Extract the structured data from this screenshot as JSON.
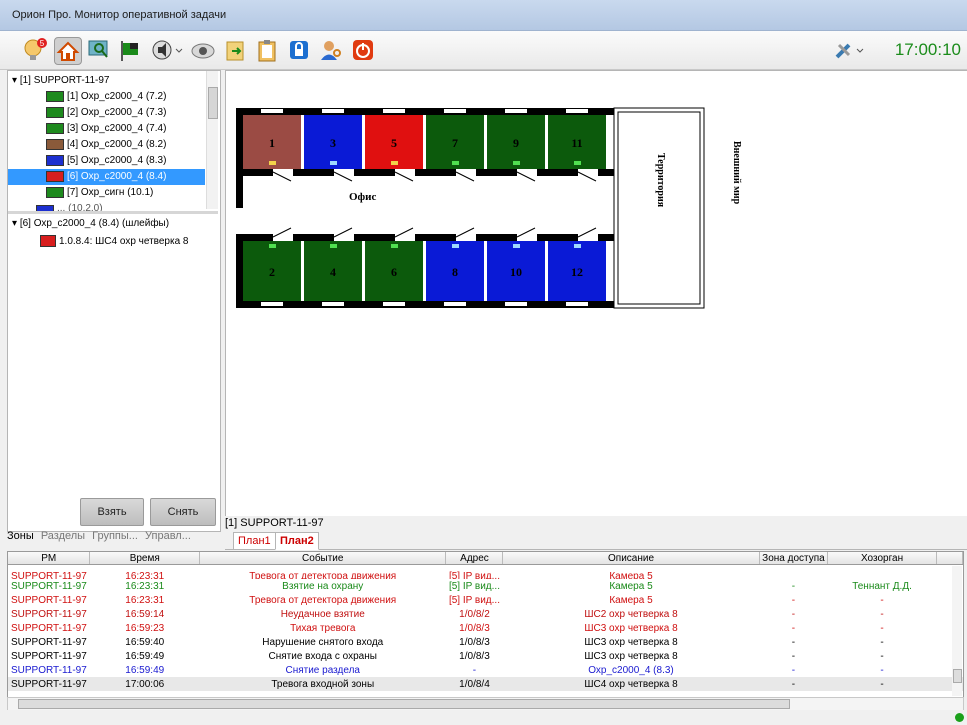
{
  "window": {
    "title": "Орион Про. Монитор оперативной задачи"
  },
  "toolbar": {
    "alert_badge": "5",
    "clock": "17:00:10",
    "icons": [
      "bulb-alert-icon",
      "home-icon",
      "screen-search-icon",
      "flag-icon",
      "speaker-icon",
      "camera-icon",
      "export-icon",
      "clipboard-icon",
      "lock-icon",
      "user-key-icon",
      "power-icon",
      "tools-icon"
    ]
  },
  "tree": {
    "root": "[1] SUPPORT-11-97",
    "items": [
      {
        "label": "[1] Охр_с2000_4 (7.2)",
        "color": "#1e8a1e"
      },
      {
        "label": "[2] Охр_с2000_4 (7.3)",
        "color": "#1e8a1e"
      },
      {
        "label": "[3] Охр_с2000_4 (7.4)",
        "color": "#1e8a1e"
      },
      {
        "label": "[4] Охр_с2000_4 (8.2)",
        "color": "#8a5a3a"
      },
      {
        "label": "[5] Охр_с2000_4 (8.3)",
        "color": "#1c2fd0"
      },
      {
        "label": "[6] Охр_с2000_4 (8.4)",
        "color": "#d81e1e",
        "selected": true
      },
      {
        "label": "[7] Охр_сигн (10.1)",
        "color": "#1e8a1e"
      }
    ],
    "partial_item": "... (10.2.0)",
    "loops_root": "[6] Охр_с2000_4 (8.4) (шлейфы)",
    "loops_item": "1.0.8.4: ШС4 охр четверка 8"
  },
  "buttons": {
    "arm": "Взять",
    "disarm": "Снять"
  },
  "left_tabs": [
    "Зоны",
    "Разделы",
    "Группы...",
    "Управл..."
  ],
  "plan": {
    "server_label": "[1] SUPPORT-11-97",
    "tabs": [
      "План1",
      "План2"
    ],
    "office_label": "Офис",
    "territory_label": "Территория",
    "outside_label": "Внешний мир",
    "rooms_top": [
      {
        "num": "1",
        "color": "#9b4b44"
      },
      {
        "num": "3",
        "color": "#0a1ad6"
      },
      {
        "num": "5",
        "color": "#e01010"
      },
      {
        "num": "7",
        "color": "#0c5a0c"
      },
      {
        "num": "9",
        "color": "#0c5a0c"
      },
      {
        "num": "11",
        "color": "#0c5a0c"
      }
    ],
    "rooms_bottom": [
      {
        "num": "2",
        "color": "#0c5a0c"
      },
      {
        "num": "4",
        "color": "#0c5a0c"
      },
      {
        "num": "6",
        "color": "#0c5a0c"
      },
      {
        "num": "8",
        "color": "#0a1ad6"
      },
      {
        "num": "10",
        "color": "#0a1ad6"
      },
      {
        "num": "12",
        "color": "#0a1ad6"
      }
    ]
  },
  "log": {
    "columns": [
      "РМ",
      "Время",
      "Событие",
      "Адрес",
      "Описание",
      "Зона доступа",
      "Хозорган"
    ],
    "rows": [
      {
        "pm": "SUPPORT-11-97",
        "time": "16:23:31",
        "event": "Тревога от детектора движения",
        "addr": "[5] IP вид...",
        "desc": "Камера 5",
        "zone": "",
        "owner": "",
        "color": "#d01010",
        "cut": true
      },
      {
        "pm": "SUPPORT-11-97",
        "time": "16:23:31",
        "event": "Взятие на охрану",
        "addr": "[5] IP вид...",
        "desc": "Камера 5",
        "zone": "-",
        "owner": "Теннант Д.Д.",
        "color": "#1a8a1a"
      },
      {
        "pm": "SUPPORT-11-97",
        "time": "16:23:31",
        "event": "Тревога от детектора движения",
        "addr": "[5] IP вид...",
        "desc": "Камера 5",
        "zone": "-",
        "owner": "-",
        "color": "#d01010"
      },
      {
        "pm": "SUPPORT-11-97",
        "time": "16:59:14",
        "event": "Неудачное взятие",
        "addr": "1/0/8/2",
        "desc": "ШС2 охр четверка 8",
        "zone": "-",
        "owner": "-",
        "color": "#c01010"
      },
      {
        "pm": "SUPPORT-11-97",
        "time": "16:59:23",
        "event": "Тихая тревога",
        "addr": "1/0/8/3",
        "desc": "ШС3 охр четверка 8",
        "zone": "-",
        "owner": "-",
        "color": "#d01010"
      },
      {
        "pm": "SUPPORT-11-97",
        "time": "16:59:40",
        "event": "Нарушение снятого входа",
        "addr": "1/0/8/3",
        "desc": "ШС3 охр четверка 8",
        "zone": "-",
        "owner": "-",
        "color": "#000000"
      },
      {
        "pm": "SUPPORT-11-97",
        "time": "16:59:49",
        "event": "Снятие входа с охраны",
        "addr": "1/0/8/3",
        "desc": "ШС3 охр четверка 8",
        "zone": "-",
        "owner": "-",
        "color": "#000000"
      },
      {
        "pm": "SUPPORT-11-97",
        "time": "16:59:49",
        "event": "Снятие раздела",
        "addr": "-",
        "desc": "Охр_с2000_4 (8.3)",
        "zone": "-",
        "owner": "-",
        "color": "#1a1ad0"
      },
      {
        "pm": "SUPPORT-11-97",
        "time": "17:00:06",
        "event": "Тревога входной зоны",
        "addr": "1/0/8/4",
        "desc": "ШС4 охр четверка 8",
        "zone": "-",
        "owner": "-",
        "color": "#000000",
        "highlight": true
      }
    ]
  }
}
